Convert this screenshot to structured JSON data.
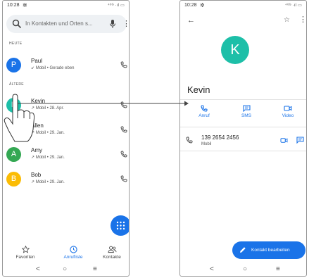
{
  "left": {
    "status": {
      "time": "10:28",
      "signal": "⁴⁶ᴳ ·ıl ▭"
    },
    "search": {
      "placeholder": "In Kontakten und Orten s..."
    },
    "sections": {
      "today": "HEUTE",
      "older": "ÄLTERE"
    },
    "contacts": [
      {
        "name": "Paul",
        "sub": "↙ Mobil • Gerade eben",
        "initial": "P",
        "color": "#1a73e8"
      },
      {
        "name": "Kevin",
        "sub": "↗ Mobil • 28. Apr.",
        "initial": "K",
        "color": "#1dbfa8"
      },
      {
        "name": "Allen",
        "sub": "↗ Mobil • 29. Jan.",
        "initial": "A",
        "color": "#ffffff"
      },
      {
        "name": "Amy",
        "sub": "↗ Mobil • 29. Jan.",
        "initial": "A",
        "color": "#34a853"
      },
      {
        "name": "Bob",
        "sub": "↗ Mobil • 29. Jan.",
        "initial": "B",
        "color": "#fbbc04"
      }
    ],
    "tabs": {
      "favorites": "Favoriten",
      "calllog": "Anrufliste",
      "contacts": "Kontakte"
    }
  },
  "right": {
    "status": {
      "time": "10:28",
      "signal": "⁴⁶ᴳ ·ıl ▭"
    },
    "contact": {
      "initial": "K",
      "name": "Kevin"
    },
    "actions": {
      "call": "Anruf",
      "sms": "SMS",
      "video": "Video"
    },
    "phone": {
      "number": "139 2654 2456",
      "type": "Mobil"
    },
    "edit_button": "Kontakt bearbeiten"
  },
  "nav": {
    "back": "<",
    "home": "○",
    "recents": "≡"
  },
  "colors": {
    "accent": "#1a73e8",
    "kevin_avatar": "#1dbfa8"
  }
}
